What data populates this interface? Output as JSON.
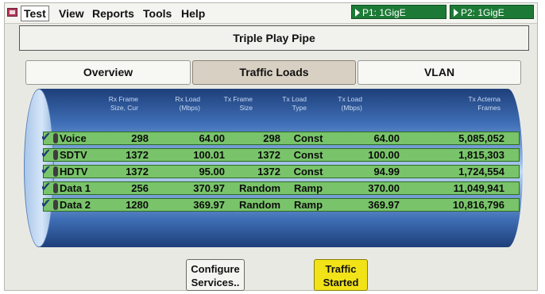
{
  "menubar": {
    "items": [
      "Test",
      "View",
      "Reports",
      "Tools",
      "Help"
    ],
    "ports": [
      "P1: 1GigE",
      "P2: 1GigE"
    ]
  },
  "title": "Triple Play Pipe",
  "tabs": [
    {
      "label": "Overview",
      "active": false
    },
    {
      "label": "Traffic Loads",
      "active": true
    },
    {
      "label": "VLAN",
      "active": false
    }
  ],
  "table": {
    "headers": [
      "Rx Frame\nSize, Cur",
      "Rx Load\n(Mbps)",
      "Tx Frame\nSize",
      "Tx Load\nType",
      "Tx Load\n(Mbps)",
      "Tx Acterna\nFrames"
    ],
    "rows": [
      {
        "name": "Voice",
        "rx_size": "298",
        "rx_load": "64.00",
        "tx_size": "298",
        "tx_type": "Const",
        "tx_load": "64.00",
        "frames": "5,085,052"
      },
      {
        "name": "SDTV",
        "rx_size": "1372",
        "rx_load": "100.01",
        "tx_size": "1372",
        "tx_type": "Const",
        "tx_load": "100.00",
        "frames": "1,815,303"
      },
      {
        "name": "HDTV",
        "rx_size": "1372",
        "rx_load": "95.00",
        "tx_size": "1372",
        "tx_type": "Const",
        "tx_load": "94.99",
        "frames": "1,724,554"
      },
      {
        "name": "Data 1",
        "rx_size": "256",
        "rx_load": "370.97",
        "tx_size": "Random",
        "tx_type": "Ramp",
        "tx_load": "370.00",
        "frames": "11,049,941"
      },
      {
        "name": "Data 2",
        "rx_size": "1280",
        "rx_load": "369.97",
        "tx_size": "Random",
        "tx_type": "Ramp",
        "tx_load": "369.97",
        "frames": "10,816,796"
      }
    ]
  },
  "buttons": {
    "configure": "Configure\nServices..",
    "traffic": "Traffic\nStarted"
  },
  "colors": {
    "row_green": "#79c46a",
    "port_green": "#1d7a36",
    "pipe_blue": "#3f6fb6",
    "traffic_button": "#f2e318"
  },
  "icons": {
    "app": "app-icon",
    "row_check": "checkmark-icon",
    "port": "play-triangle-icon"
  }
}
